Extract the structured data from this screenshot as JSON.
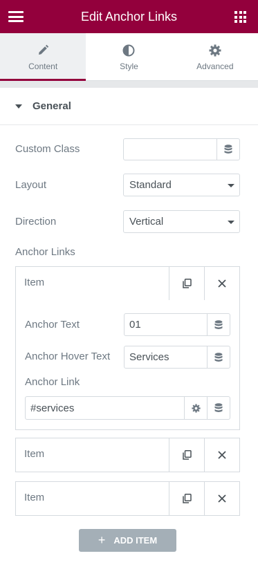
{
  "header": {
    "title": "Edit Anchor Links",
    "menu_icon": "hamburger-icon",
    "apps_icon": "grid-icon"
  },
  "tabs": [
    {
      "label": "Content",
      "icon": "pencil-icon",
      "active": true
    },
    {
      "label": "Style",
      "icon": "half-circle-icon",
      "active": false
    },
    {
      "label": "Advanced",
      "icon": "gear-icon",
      "active": false
    }
  ],
  "colors": {
    "brand": "#93003c",
    "button_gray": "#a4afb7"
  },
  "section": {
    "label": "General"
  },
  "fields": {
    "custom_class": {
      "label": "Custom Class",
      "value": ""
    },
    "layout": {
      "label": "Layout",
      "value": "Standard"
    },
    "direction": {
      "label": "Direction",
      "value": "Vertical"
    }
  },
  "anchor_links": {
    "label": "Anchor Links",
    "items": [
      {
        "title": "Item"
      },
      {
        "title": "Item"
      },
      {
        "title": "Item"
      }
    ],
    "expanded": {
      "anchor_text_label": "Anchor Text",
      "anchor_text_value": "01",
      "hover_text_label": "Anchor Hover Text",
      "hover_text_value": "Services",
      "link_label": "Anchor Link",
      "link_value": "#services"
    },
    "add_label": "ADD ITEM"
  }
}
